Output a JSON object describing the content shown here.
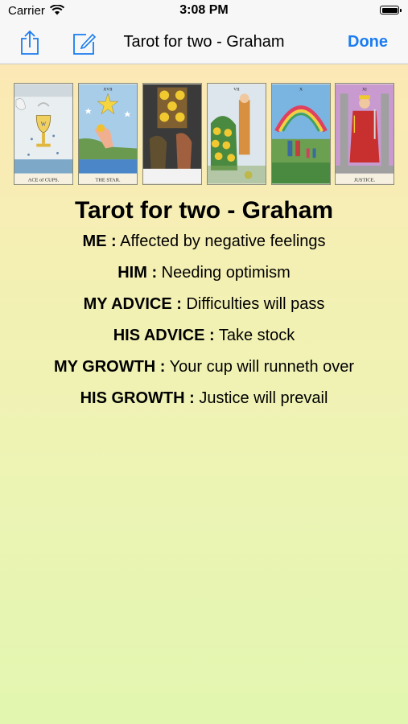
{
  "status": {
    "carrier": "Carrier",
    "time": "3:08 PM"
  },
  "nav": {
    "title": "Tarot for two - Graham",
    "done_label": "Done"
  },
  "cards": [
    {
      "name": "Ace of Cups",
      "caption": "ACE of CUPS."
    },
    {
      "name": "The Star",
      "caption": "THE STAR."
    },
    {
      "name": "Five of Pentacles",
      "caption": ""
    },
    {
      "name": "Seven of Pentacles",
      "caption": ""
    },
    {
      "name": "Ten of Cups",
      "caption": ""
    },
    {
      "name": "Justice",
      "caption": "JUSTICE."
    }
  ],
  "reading": {
    "title": "Tarot for two - Graham",
    "lines": [
      {
        "label": "ME :",
        "value": " Affected by negative feelings"
      },
      {
        "label": "HIM :",
        "value": " Needing optimism"
      },
      {
        "label": "MY ADVICE :",
        "value": " Difficulties will pass"
      },
      {
        "label": "HIS ADVICE :",
        "value": " Take stock"
      },
      {
        "label": "MY GROWTH :",
        "value": " Your cup will runneth over"
      },
      {
        "label": "HIS GROWTH :",
        "value": " Justice will prevail"
      }
    ]
  },
  "colors": {
    "accent": "#1a7cf0",
    "bar": "#f7f7f7",
    "bg_top": "#fce8b4",
    "bg_bottom": "#e2f6b0"
  }
}
